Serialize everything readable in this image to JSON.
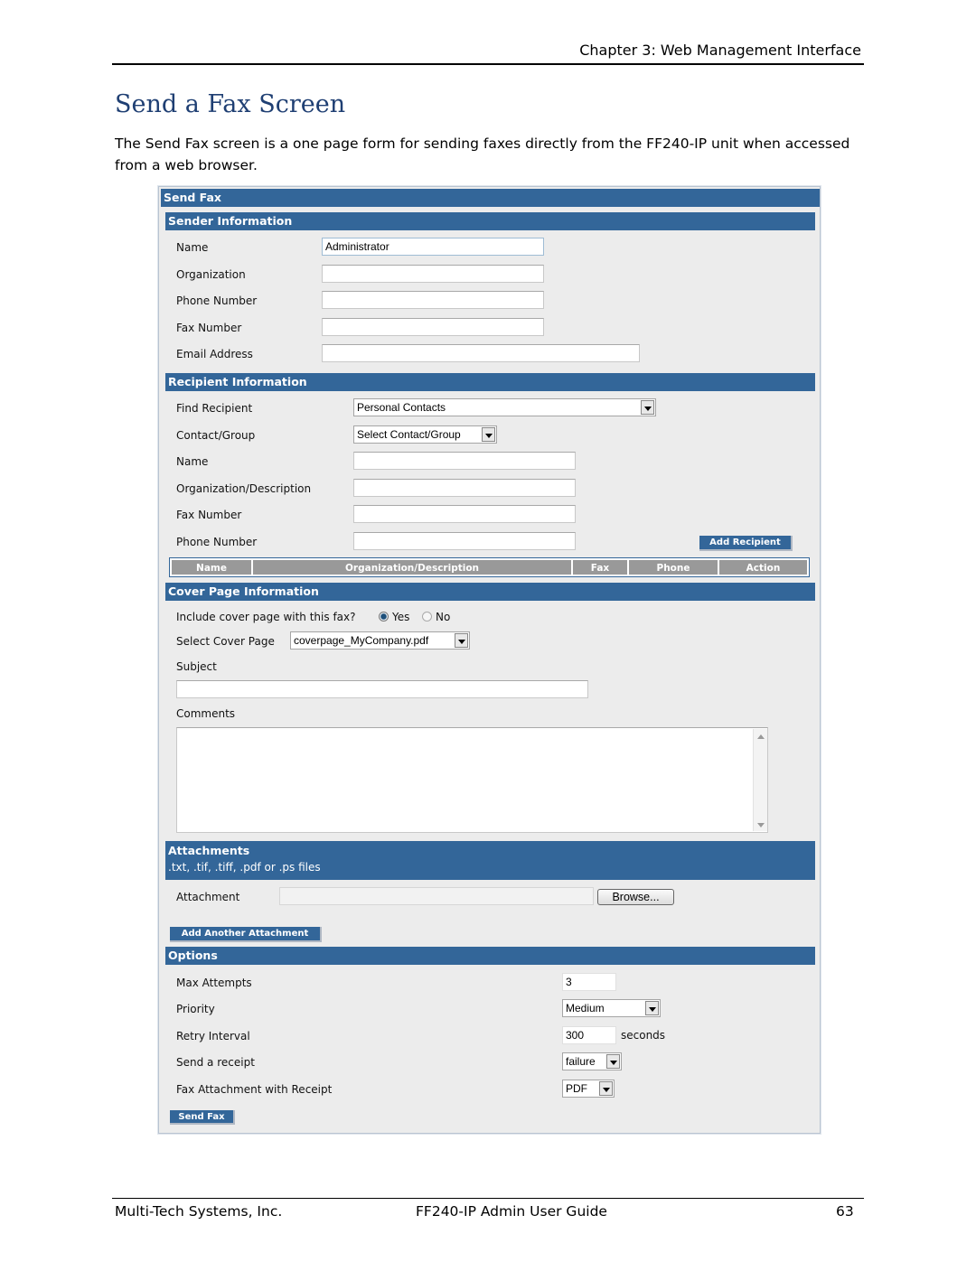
{
  "page_header": {
    "chapter": "Chapter 3: Web Management Interface"
  },
  "section_title": "Send a Fax Screen",
  "intro": "The Send Fax screen is a one page form for sending faxes directly from the FF240-IP unit when accessed from a web browser.",
  "form": {
    "title": "Send Fax",
    "sender": {
      "header": "Sender Information",
      "fields": [
        {
          "label": "Name",
          "value": "Administrator"
        },
        {
          "label": "Organization",
          "value": ""
        },
        {
          "label": "Phone Number",
          "value": ""
        },
        {
          "label": "Fax Number",
          "value": ""
        },
        {
          "label": "Email Address",
          "value": ""
        }
      ]
    },
    "recipient": {
      "header": "Recipient Information",
      "find_label": "Find Recipient",
      "find_value": "Personal Contacts",
      "contact_label": "Contact/Group",
      "contact_value": "Select Contact/Group",
      "fields": [
        {
          "label": "Name",
          "value": ""
        },
        {
          "label": "Organization/Description",
          "value": ""
        },
        {
          "label": "Fax Number",
          "value": ""
        },
        {
          "label": "Phone Number",
          "value": ""
        }
      ],
      "add_button": "Add Recipient",
      "table_columns": [
        "Name",
        "Organization/Description",
        "Fax",
        "Phone",
        "Action"
      ]
    },
    "cover": {
      "header": "Cover Page Information",
      "include_label": "Include cover page with this fax?",
      "yes_label": "Yes",
      "no_label": "No",
      "include_selected": "Yes",
      "select_label": "Select Cover Page",
      "select_value": "coverpage_MyCompany.pdf",
      "subject_label": "Subject",
      "subject_value": "",
      "comments_label": "Comments",
      "comments_value": ""
    },
    "attachments": {
      "header": "Attachments",
      "subheader": ".txt, .tif, .tiff, .pdf or .ps files",
      "attachment_label": "Attachment",
      "browse_button": "Browse...",
      "add_another_button": "Add Another Attachment"
    },
    "options": {
      "header": "Options",
      "max_attempts_label": "Max Attempts",
      "max_attempts_value": "3",
      "priority_label": "Priority",
      "priority_value": "Medium",
      "retry_label": "Retry Interval",
      "retry_value": "300",
      "retry_unit": "seconds",
      "receipt_label": "Send a receipt",
      "receipt_value": "failure",
      "fax_attach_label": "Fax Attachment with Receipt",
      "fax_attach_value": "PDF"
    },
    "send_button": "Send Fax"
  },
  "footer": {
    "company": "Multi-Tech Systems, Inc.",
    "guide": "FF240-IP Admin User Guide",
    "page": "63"
  },
  "colors": {
    "bar": "#336699",
    "title": "#1f3f73",
    "table_header": "#999999",
    "panel": "#ececec"
  }
}
